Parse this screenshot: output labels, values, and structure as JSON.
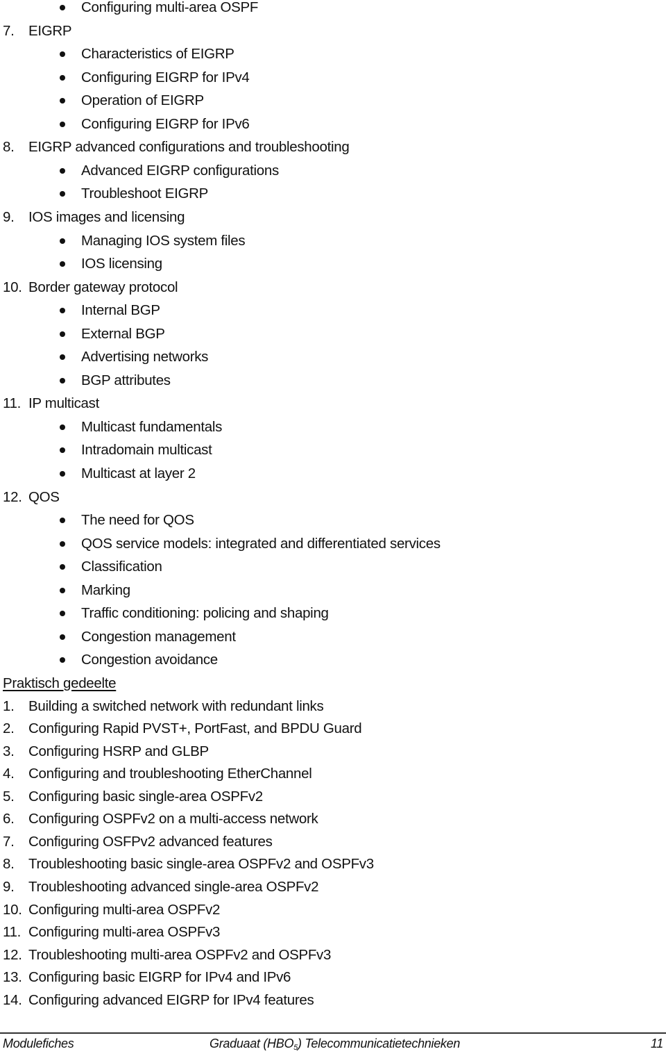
{
  "theory_continued": [
    {
      "number": null,
      "bullets": [
        "Configuring multi-area OSPF"
      ]
    },
    {
      "number": "7.",
      "title": "EIGRP",
      "bullets": [
        "Characteristics of EIGRP",
        "Configuring EIGRP for IPv4",
        "Operation of EIGRP",
        "Configuring EIGRP for IPv6"
      ]
    },
    {
      "number": "8.",
      "title": "EIGRP advanced configurations and troubleshooting",
      "bullets": [
        "Advanced EIGRP configurations",
        "Troubleshoot EIGRP"
      ]
    },
    {
      "number": "9.",
      "title": "IOS images and licensing",
      "bullets": [
        "Managing IOS system files",
        "IOS licensing"
      ]
    },
    {
      "number": "10.",
      "title": "Border gateway protocol",
      "bullets": [
        "Internal BGP",
        "External BGP",
        "Advertising networks",
        "BGP attributes"
      ]
    },
    {
      "number": "11.",
      "title": "IP multicast",
      "bullets": [
        "Multicast fundamentals",
        "Intradomain multicast",
        "Multicast at layer 2"
      ]
    },
    {
      "number": "12.",
      "title": "QOS",
      "bullets": [
        "The need for QOS",
        "QOS service models: integrated and differentiated services",
        "Classification",
        "Marking",
        "Traffic conditioning: policing and shaping",
        "Congestion management",
        "Congestion avoidance"
      ]
    }
  ],
  "practical": {
    "heading": "Praktisch gedeelte",
    "items": [
      {
        "number": "1.",
        "text": "Building a switched network with redundant links"
      },
      {
        "number": "2.",
        "text": "Configuring Rapid PVST+, PortFast, and BPDU Guard"
      },
      {
        "number": "3.",
        "text": "Configuring HSRP and GLBP"
      },
      {
        "number": "4.",
        "text": "Configuring and troubleshooting EtherChannel"
      },
      {
        "number": "5.",
        "text": "Configuring basic single-area OSPFv2"
      },
      {
        "number": "6.",
        "text": "Configuring OSPFv2 on a multi-access network"
      },
      {
        "number": "7.",
        "text": "Configuring OSFPv2 advanced features"
      },
      {
        "number": "8.",
        "text": "Troubleshooting basic single-area OSPFv2 and OSPFv3"
      },
      {
        "number": "9.",
        "text": "Troubleshooting advanced single-area OSPFv2"
      },
      {
        "number": "10.",
        "text": "Configuring multi-area OSPFv2"
      },
      {
        "number": "11.",
        "text": "Configuring multi-area OSPFv3"
      },
      {
        "number": "12.",
        "text": "Troubleshooting multi-area OSPFv2 and OSPFv3"
      },
      {
        "number": "13.",
        "text": "Configuring basic EIGRP for IPv4 and IPv6"
      },
      {
        "number": "14.",
        "text": "Configuring advanced EIGRP for IPv4 features"
      }
    ]
  },
  "footer": {
    "left": "Modulefiches",
    "center_prefix": "Graduaat (HBO",
    "center_sub": "5",
    "center_suffix": ") Telecommunicatietechnieken",
    "page_number": "11"
  }
}
